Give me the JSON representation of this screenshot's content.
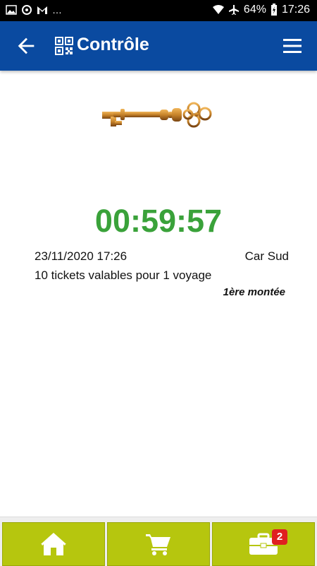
{
  "status_bar": {
    "overflow": "…",
    "battery": "64%",
    "time": "17:26"
  },
  "app_bar": {
    "title": "Contrôle"
  },
  "ticket": {
    "timer": "00:59:57",
    "date": "23/11/2020 17:26",
    "company": "Car Sud",
    "description": "10 tickets valables pour 1 voyage",
    "boarding": "1ère montée"
  },
  "bottom_nav": {
    "cart_badge": "2"
  },
  "colors": {
    "primary": "#0a4aa0",
    "timer_green": "#3aa23a",
    "nav_button": "#b6c60e",
    "badge": "#e02020"
  }
}
